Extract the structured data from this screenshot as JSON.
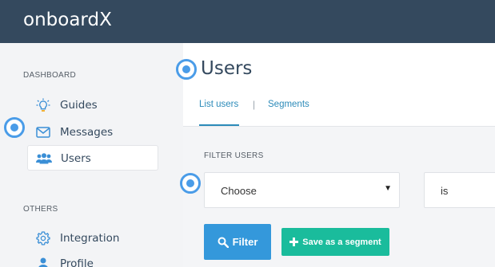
{
  "app": {
    "brand": "onboardX"
  },
  "colors": {
    "topbar": "#34495e",
    "accent": "#2c8bb9",
    "hotspot": "#4a9ce8",
    "filter_button": "#3498db",
    "save_button": "#1abc9c"
  },
  "sidebar": {
    "sections": [
      {
        "heading": "DASHBOARD",
        "items": [
          {
            "label": "Guides",
            "icon": "lightbulb-icon",
            "active": false
          },
          {
            "label": "Messages",
            "icon": "envelope-icon",
            "active": false
          },
          {
            "label": "Users",
            "icon": "users-icon",
            "active": true
          }
        ]
      },
      {
        "heading": "OTHERS",
        "items": [
          {
            "label": "Integration",
            "icon": "gear-icon",
            "active": false
          },
          {
            "label": "Profile",
            "icon": "user-icon",
            "active": false
          }
        ]
      }
    ]
  },
  "main": {
    "title": "Users",
    "tabs": [
      {
        "label": "List users",
        "active": true
      },
      {
        "label": "Segments",
        "active": false
      }
    ],
    "filter": {
      "label": "FILTER USERS",
      "field_select": {
        "value": "Choose"
      },
      "operator_select": {
        "value": "is"
      },
      "filter_button": "Filter",
      "save_button": "Save as a segment"
    }
  },
  "hotspots": [
    "title-hotspot",
    "messages-hotspot",
    "filter-hotspot"
  ]
}
